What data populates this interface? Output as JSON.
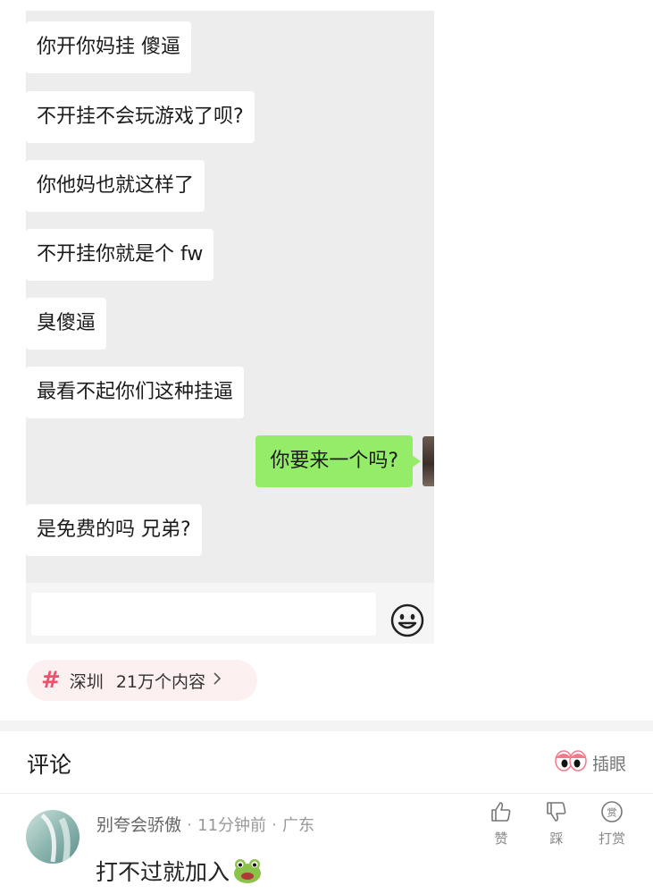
{
  "chat": {
    "messages_left": [
      "你开你妈挂 傻逼",
      "不开挂不会玩游戏了呗?",
      "你他妈也就这样了",
      "不开挂你就是个 fw",
      "臭傻逼",
      "最看不起你们这种挂逼",
      "是免费的吗  兄弟?"
    ],
    "message_right": "你要来一个吗?",
    "emoji_icon": "smiley-face-icon"
  },
  "topic": {
    "hash": "#",
    "name": "深圳",
    "count": "21万个内容",
    "accent": "#f0506b"
  },
  "comments": {
    "title": "评论",
    "peek_label": "插眼",
    "items": [
      {
        "username": "别夸会骄傲",
        "time": "11分钟前",
        "location": "广东",
        "text": "打不过就加入",
        "emoji": "frog-face-icon",
        "actions": {
          "like": "赞",
          "dislike": "踩",
          "tip": "打赏"
        }
      }
    ]
  },
  "colors": {
    "chat_bg": "#ededed",
    "bubble_left": "#ffffff",
    "bubble_right": "#95ec69"
  }
}
